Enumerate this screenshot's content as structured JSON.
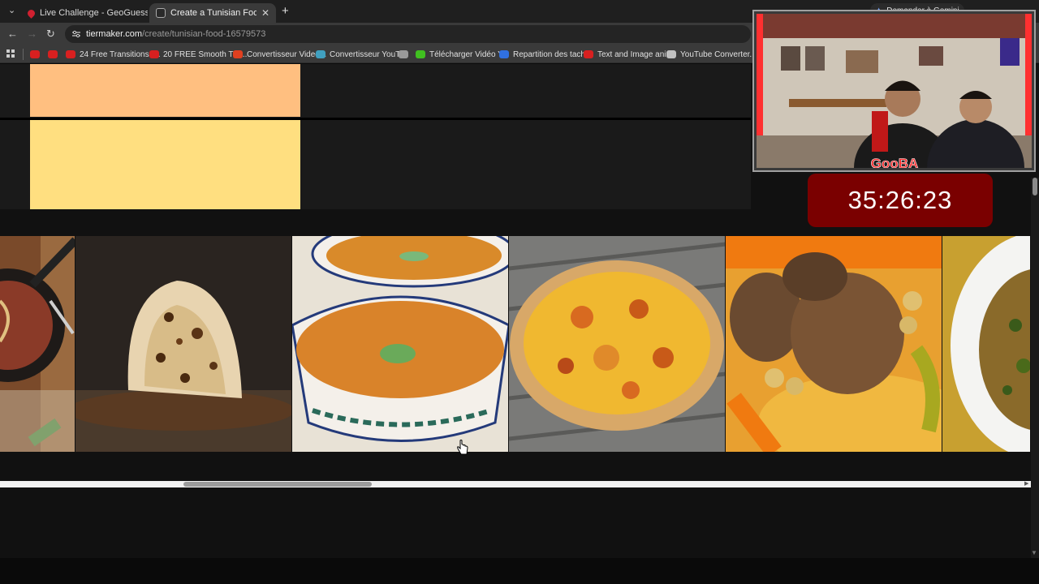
{
  "browser": {
    "tabs": [
      {
        "title": "Live Challenge - GeoGuessr",
        "active": false
      },
      {
        "title": "Create a Tunisian Food Tier List",
        "active": true
      }
    ],
    "close_glyph": "✕",
    "new_tab_glyph": "+",
    "tab_list_glyph": "⌄",
    "address": {
      "host": "tiermaker.com",
      "path": "/create/tunisian-food-16579573"
    },
    "nav": {
      "back": "←",
      "forward": "→",
      "reload": "↻"
    },
    "bookmarks": [
      {
        "label": "",
        "color": "#d82020"
      },
      {
        "label": "",
        "color": "#d82020"
      },
      {
        "label": "24 Free Transitions f...",
        "color": "#d82020"
      },
      {
        "label": "20 FREE Smooth Tra...",
        "color": "#d82020"
      },
      {
        "label": "Convertisseur Video...",
        "color": "#e04020"
      },
      {
        "label": "Convertisseur YouT...",
        "color": "#40a0c0"
      },
      {
        "label": "",
        "color": "#9a9a9a"
      },
      {
        "label": "Télécharger Vidéo Y...",
        "color": "#40c020"
      },
      {
        "label": "Repartition des tach...",
        "color": "#3070e0"
      },
      {
        "label": "Text and Image ani...",
        "color": "#d82020"
      },
      {
        "label": "YouTube Converter...",
        "color": "#c0c0c0"
      }
    ]
  },
  "gemini": {
    "label": "Demander à Gemini"
  },
  "overlay": {
    "timer": "35:26:23",
    "cam_sign": "GooBA",
    "accent": "#7a0000"
  },
  "tiers": [
    {
      "color": "#ffbf80"
    },
    {
      "color": "#ffdf80"
    }
  ],
  "tiles": [
    {
      "name": "tile-lablabi-pan"
    },
    {
      "name": "tile-mlawi-bread"
    },
    {
      "name": "tile-chorba-soup"
    },
    {
      "name": "tile-pizza"
    },
    {
      "name": "tile-couscous-meat"
    },
    {
      "name": "tile-rice-dish"
    }
  ]
}
